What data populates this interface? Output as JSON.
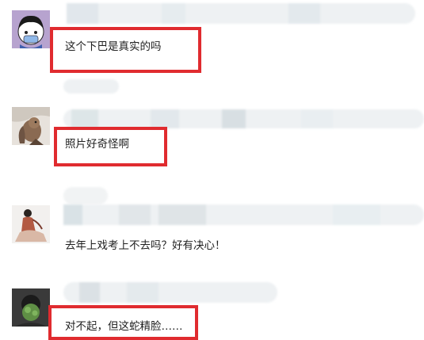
{
  "comments": [
    {
      "text": "这个下巴是真实的吗",
      "avatar": "cartoon-girl-avatar"
    },
    {
      "text": "照片好奇怪啊",
      "avatar": "squirrel-photo-avatar"
    },
    {
      "text": "去年上戏考上不去吗？好有决心！",
      "avatar": "costume-figure-avatar"
    },
    {
      "text": "对不起，但这蛇精脸……",
      "avatar": "dark-photo-avatar"
    }
  ],
  "colors": {
    "highlight": "#e02b2f",
    "text": "#1f1f1f",
    "blur_light": "#eef1f3",
    "blur_mid": "#dfe6ea"
  }
}
